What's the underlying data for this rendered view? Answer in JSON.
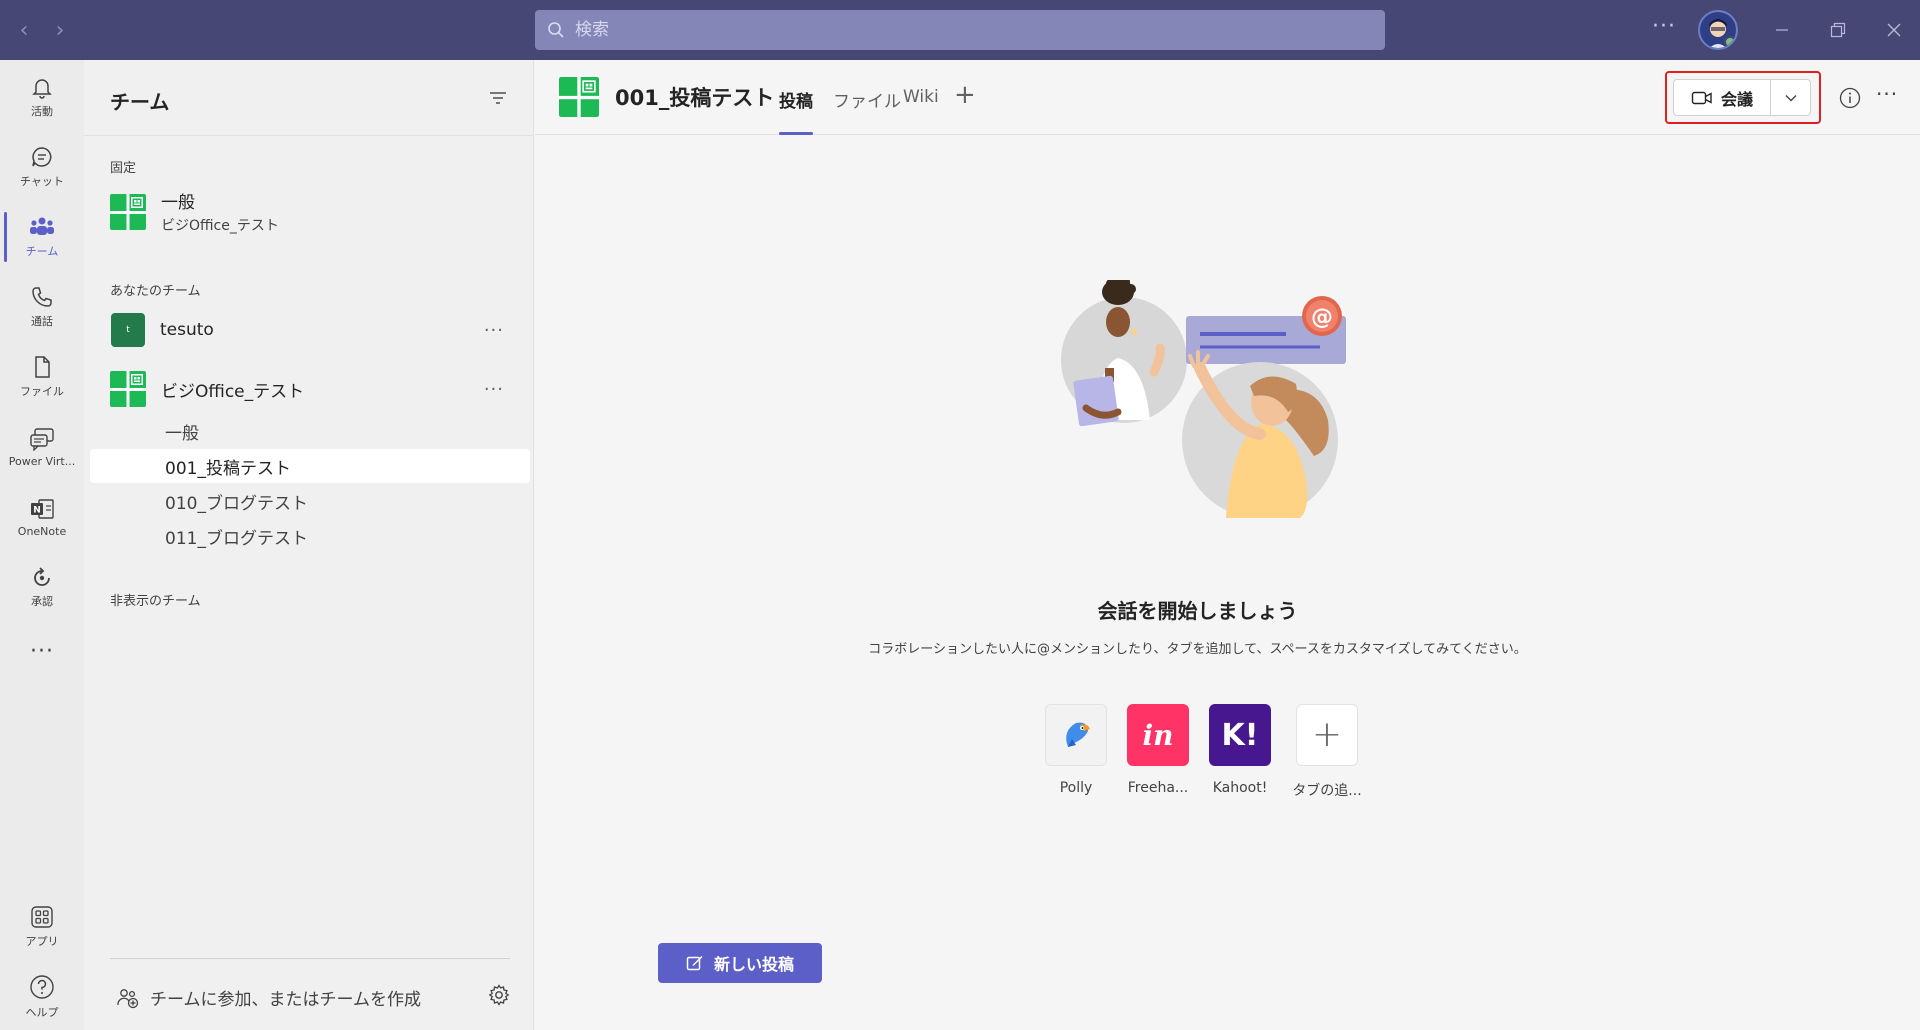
{
  "search": {
    "placeholder": "検索"
  },
  "titlebar": {
    "more": "···"
  },
  "rail": {
    "items": [
      {
        "label": "活動"
      },
      {
        "label": "チャット"
      },
      {
        "label": "チーム"
      },
      {
        "label": "通話"
      },
      {
        "label": "ファイル"
      },
      {
        "label": "Power Virt..."
      },
      {
        "label": "OneNote"
      },
      {
        "label": "承認"
      },
      {
        "label": "···"
      },
      {
        "label": "アプリ"
      },
      {
        "label": "ヘルプ"
      }
    ]
  },
  "panel": {
    "title": "チーム",
    "pinned_label": "固定",
    "pinned": {
      "name": "一般",
      "team": "ビジOffice_テスト"
    },
    "your_teams_label": "あなたのチーム",
    "teams": [
      {
        "name": "tesuto",
        "initial": "t",
        "more": "···"
      },
      {
        "name": "ビジOffice_テスト",
        "more": "···"
      }
    ],
    "channels": [
      {
        "name": "一般"
      },
      {
        "name": "001_投稿テスト"
      },
      {
        "name": "010_ブログテスト"
      },
      {
        "name": "011_ブログテスト"
      }
    ],
    "hidden_label": "非表示のチーム",
    "join_label": "チームに参加、またはチームを作成"
  },
  "main": {
    "channel_title": "001_投稿テスト",
    "tabs": [
      {
        "label": "投稿"
      },
      {
        "label": "ファイル"
      },
      {
        "label": "Wiki"
      }
    ],
    "add_tab": "+",
    "meet_label": "会議",
    "more": "···",
    "empty_title": "会話を開始しましょう",
    "empty_desc": "コラボレーションしたい人に@メンションしたり、タブを追加して、スペースをカスタマイズしてみてください。",
    "apps": [
      {
        "label": "Polly",
        "icon": "polly-icon"
      },
      {
        "label": "Freeha...",
        "glyph": "in",
        "color": "#ff3366"
      },
      {
        "label": "Kahoot!",
        "glyph": "K!",
        "color": "#46178f"
      },
      {
        "label": "タブの追...",
        "glyph": "+"
      }
    ],
    "new_post_label": "新しい投稿"
  },
  "colors": {
    "brand": "#464775",
    "accent": "#5b5fc7",
    "teams_green": "#1db954",
    "highlight": "#e02020"
  }
}
